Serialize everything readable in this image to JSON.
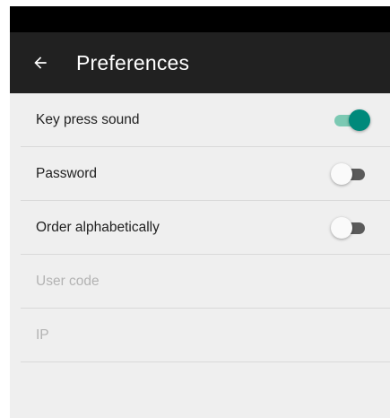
{
  "app_bar": {
    "title": "Preferences",
    "back_icon": "arrow-back-icon"
  },
  "colors": {
    "app_bar_bg": "#212121",
    "status_bar_bg": "#000000",
    "accent": "#00897b",
    "accent_track": "#7cc9b3",
    "screen_bg": "#efefef"
  },
  "preferences": [
    {
      "label": "Key press sound",
      "type": "switch",
      "checked": true,
      "enabled": true
    },
    {
      "label": "Password",
      "type": "switch",
      "checked": false,
      "enabled": true
    },
    {
      "label": "Order alphabetically",
      "type": "switch",
      "checked": false,
      "enabled": true
    },
    {
      "label": "User code",
      "type": "text",
      "enabled": false
    },
    {
      "label": "IP",
      "type": "text",
      "enabled": false
    }
  ]
}
